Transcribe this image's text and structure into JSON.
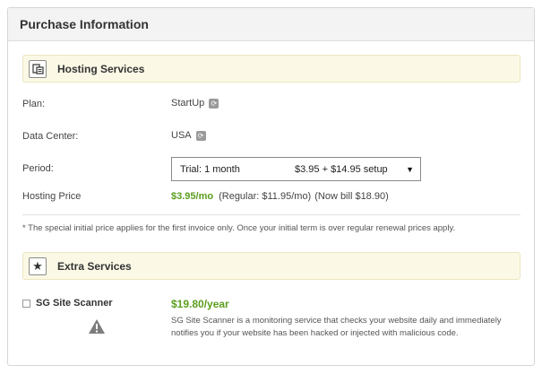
{
  "header": {
    "title": "Purchase Information"
  },
  "hosting": {
    "section_title": "Hosting Services",
    "icon": "server-stack-icon",
    "plan_label": "Plan:",
    "plan_value": "StartUp",
    "datacenter_label": "Data Center:",
    "datacenter_value": "USA",
    "period_label": "Period:",
    "period_selected_term": "Trial: 1 month",
    "period_selected_price": "$3.95 + $14.95 setup",
    "price_label": "Hosting Price",
    "price_value": "$3.95/mo",
    "price_regular": "(Regular: $11.95/mo)",
    "price_now_bill": "(Now bill $18.90)"
  },
  "note": "* The special initial price applies for the first invoice only. Once your initial term is over regular renewal prices apply.",
  "extra": {
    "section_title": "Extra Services",
    "icon": "star-icon",
    "scanner_label": "SG Site Scanner",
    "scanner_checked": false,
    "scanner_price": "$19.80/year",
    "scanner_description": "SG Site Scanner is a monitoring service that checks your website daily and immediately notifies you if your website has been hacked or injected with malicious code."
  },
  "colors": {
    "accent_green": "#5a9e1e",
    "section_bg": "#fbf9e6"
  }
}
